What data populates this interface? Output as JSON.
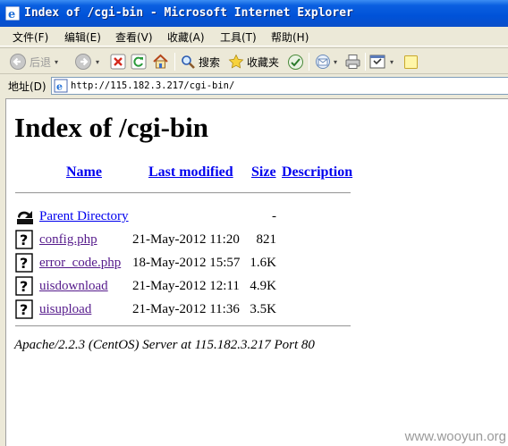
{
  "window": {
    "title": "Index of /cgi-bin - Microsoft Internet Explorer"
  },
  "menu": [
    "文件(F)",
    "编辑(E)",
    "查看(V)",
    "收藏(A)",
    "工具(T)",
    "帮助(H)"
  ],
  "toolbar": {
    "back_label": "后退",
    "search_label": "搜索",
    "favorites_label": "收藏夹"
  },
  "address": {
    "label": "地址(D)",
    "url": "http://115.182.3.217/cgi-bin/"
  },
  "page": {
    "heading": "Index of /cgi-bin",
    "columns": {
      "name": "Name",
      "last_modified": "Last modified",
      "size": "Size",
      "description": "Description"
    },
    "entries": [
      {
        "name": "Parent Directory",
        "date": "",
        "size": "-",
        "type": "parent",
        "visited": false
      },
      {
        "name": "config.php",
        "date": "21-May-2012 11:20",
        "size": "821",
        "type": "file",
        "visited": true
      },
      {
        "name": "error_code.php",
        "date": "18-May-2012 15:57",
        "size": "1.6K",
        "type": "file",
        "visited": true
      },
      {
        "name": "uisdownload",
        "date": "21-May-2012 12:11",
        "size": "4.9K",
        "type": "file",
        "visited": true
      },
      {
        "name": "uisupload",
        "date": "21-May-2012 11:36",
        "size": "3.5K",
        "type": "file",
        "visited": true
      }
    ],
    "footer": "Apache/2.2.3 (CentOS) Server at 115.182.3.217 Port 80"
  },
  "watermark": "www.wooyun.org",
  "colors": {
    "link": "#0000ee",
    "visited_link": "#551a8b",
    "titlebar": "#0052d8"
  }
}
